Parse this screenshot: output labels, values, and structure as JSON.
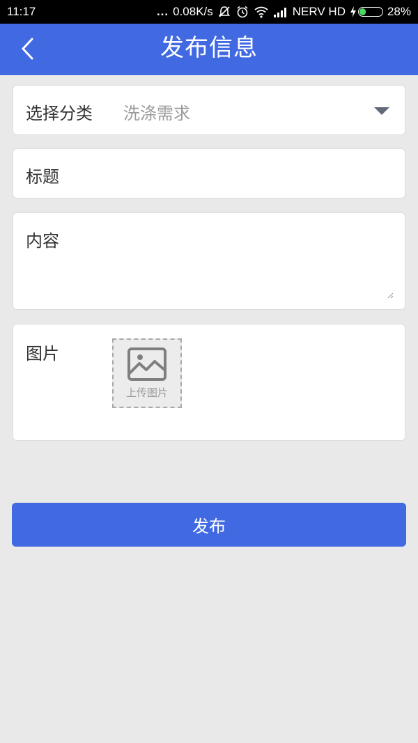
{
  "status_bar": {
    "time": "11:17",
    "dots": "...",
    "speed": "0.08K/s",
    "carrier": "NERV HD",
    "battery": "28%",
    "icons": [
      "notification-off-icon",
      "alarm-icon",
      "wifi-icon",
      "signal-icon",
      "charging-icon",
      "battery-icon"
    ],
    "battery_level": 0.28,
    "battery_color": "#4cd964"
  },
  "header": {
    "title": "发布信息",
    "back_icon": "chevron-left-icon",
    "background": "#4169e1"
  },
  "form": {
    "category": {
      "label": "选择分类",
      "value": "洗涤需求",
      "icon": "caret-down-icon"
    },
    "title_field": {
      "label": "标题",
      "value": "",
      "placeholder": ""
    },
    "content_field": {
      "label": "内容",
      "value": "",
      "placeholder": ""
    },
    "image_field": {
      "label": "图片",
      "upload_label": "上传图片",
      "upload_icon": "image-icon"
    }
  },
  "actions": {
    "publish_label": "发布",
    "accent": "#4169e1"
  }
}
